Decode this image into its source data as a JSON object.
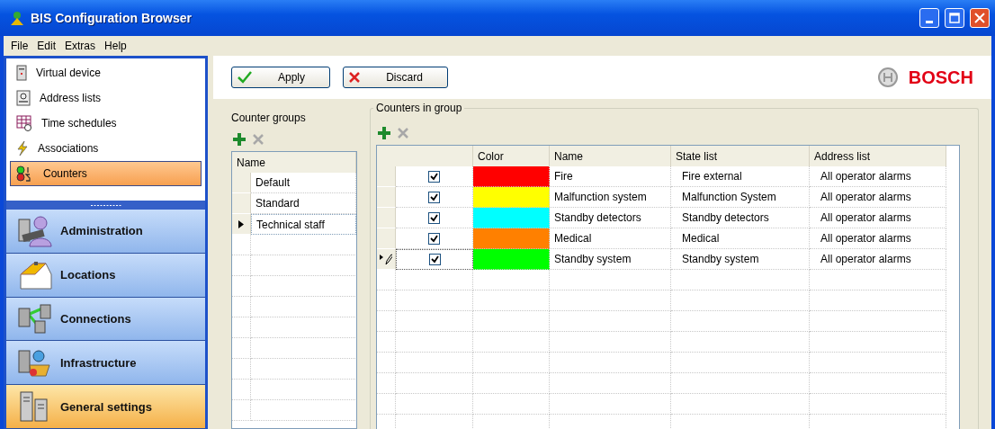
{
  "window": {
    "title": "BIS Configuration Browser"
  },
  "menu": [
    "File",
    "Edit",
    "Extras",
    "Help"
  ],
  "sidebar": {
    "items": [
      {
        "label": "Virtual device",
        "kind": "device",
        "selected": false
      },
      {
        "label": "Address lists",
        "kind": "address",
        "selected": false
      },
      {
        "label": "Time schedules",
        "kind": "schedule",
        "selected": false
      },
      {
        "label": "Associations",
        "kind": "association",
        "selected": false
      },
      {
        "label": "Counters",
        "kind": "counter",
        "selected": true
      }
    ],
    "sections": [
      {
        "label": "Administration",
        "kind": "admin",
        "selected": false
      },
      {
        "label": "Locations",
        "kind": "house",
        "selected": false
      },
      {
        "label": "Connections",
        "kind": "connection",
        "selected": false
      },
      {
        "label": "Infrastructure",
        "kind": "infra",
        "selected": false
      },
      {
        "label": "General settings",
        "kind": "settings",
        "selected": true
      }
    ]
  },
  "toolbar": {
    "buttons": [
      {
        "label": "Apply",
        "kind": "apply"
      },
      {
        "label": "Discard",
        "kind": "discard"
      }
    ],
    "brand": "BOSCH"
  },
  "counter_groups": {
    "title": "Counter groups",
    "columns": [
      "Name"
    ],
    "rows": [
      {
        "name": "Default",
        "selected": false
      },
      {
        "name": "Standard",
        "selected": false
      },
      {
        "name": "Technical staff",
        "selected": true
      }
    ]
  },
  "counters": {
    "title": "Counters in group",
    "columns": [
      "Color",
      "Name",
      "State list",
      "Address list"
    ],
    "rows": [
      {
        "enabled": true,
        "color": "#ff0000",
        "name": "Fire",
        "state_list": "Fire external",
        "address_list": "All operator alarms",
        "editing": false
      },
      {
        "enabled": true,
        "color": "#ffff00",
        "name": "Malfunction system",
        "state_list": "Malfunction System",
        "address_list": "All operator alarms",
        "editing": false
      },
      {
        "enabled": true,
        "color": "#00ffff",
        "name": "Standby detectors",
        "state_list": "Standby detectors",
        "address_list": "All operator alarms",
        "editing": false
      },
      {
        "enabled": true,
        "color": "#ff8000",
        "name": "Medical",
        "state_list": "Medical",
        "address_list": "All operator alarms",
        "editing": false
      },
      {
        "enabled": true,
        "color": "#00ff00",
        "name": "Standby system",
        "state_list": "Standby system",
        "address_list": "All operator alarms",
        "editing": true
      }
    ]
  }
}
